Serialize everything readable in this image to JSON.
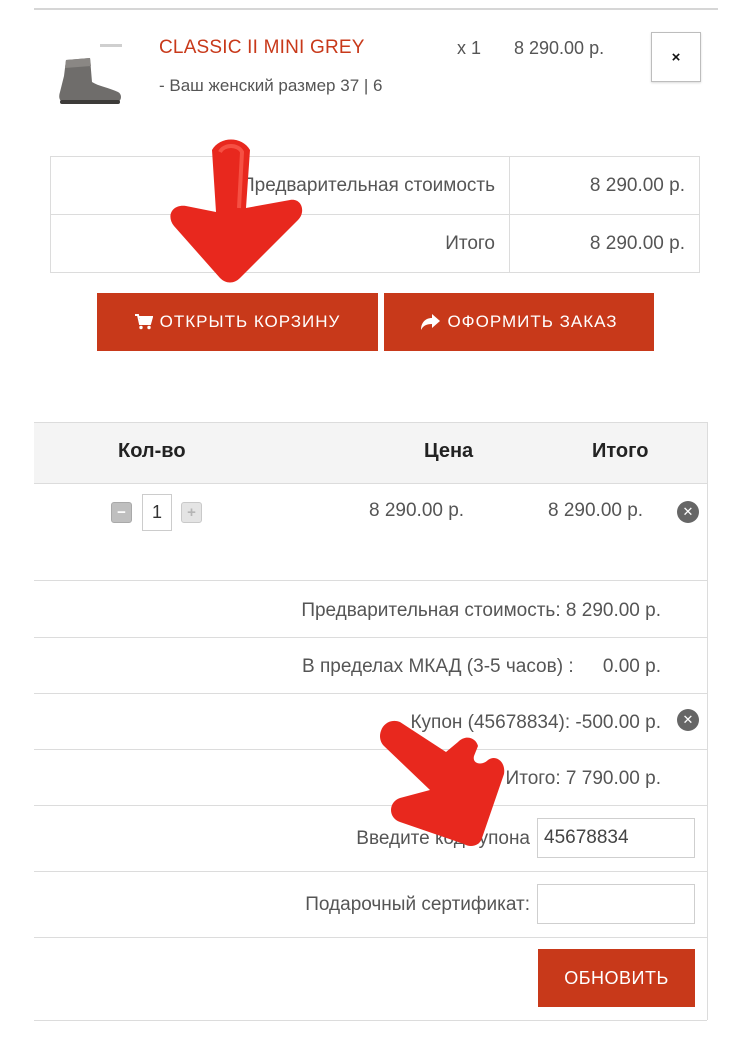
{
  "mini_cart": {
    "product": {
      "name": "CLASSIC II MINI GREY",
      "quantity": "x 1",
      "price": "8 290.00 р.",
      "size": "- Ваш женский размер 37 | 6",
      "remove": "×"
    },
    "summary": [
      {
        "label": "Предварительная стоимость",
        "value": "8 290.00 р."
      },
      {
        "label": "Итого",
        "value": "8 290.00 р."
      }
    ],
    "buttons": {
      "open_cart": "ОТКРЫТЬ КОРЗИНУ",
      "checkout": "ОФОРМИТЬ ЗАКАЗ"
    }
  },
  "cart": {
    "headers": {
      "qty": "Кол-во",
      "price": "Цена",
      "total": "Итого"
    },
    "item": {
      "quantity": "1",
      "price": "8 290.00 р.",
      "total": "8 290.00 р."
    },
    "totals": [
      {
        "label": "Предварительная стоимость:",
        "value": "8 290.00 р."
      },
      {
        "label": "В пределах МКАД  (3-5 часов) :",
        "value": "0.00 р."
      },
      {
        "label": "Купон (45678834):",
        "value": "-500.00 р."
      },
      {
        "label": "Итого:",
        "value": "7 790.00 р."
      }
    ],
    "coupon_label": "Введите код купона",
    "coupon_value": "45678834",
    "gift_label": "Подарочный сертификат:",
    "gift_value": "",
    "update_button": "ОБНОВИТЬ"
  },
  "colors": {
    "accent": "#c8391a",
    "arrow": "#e8281e"
  }
}
